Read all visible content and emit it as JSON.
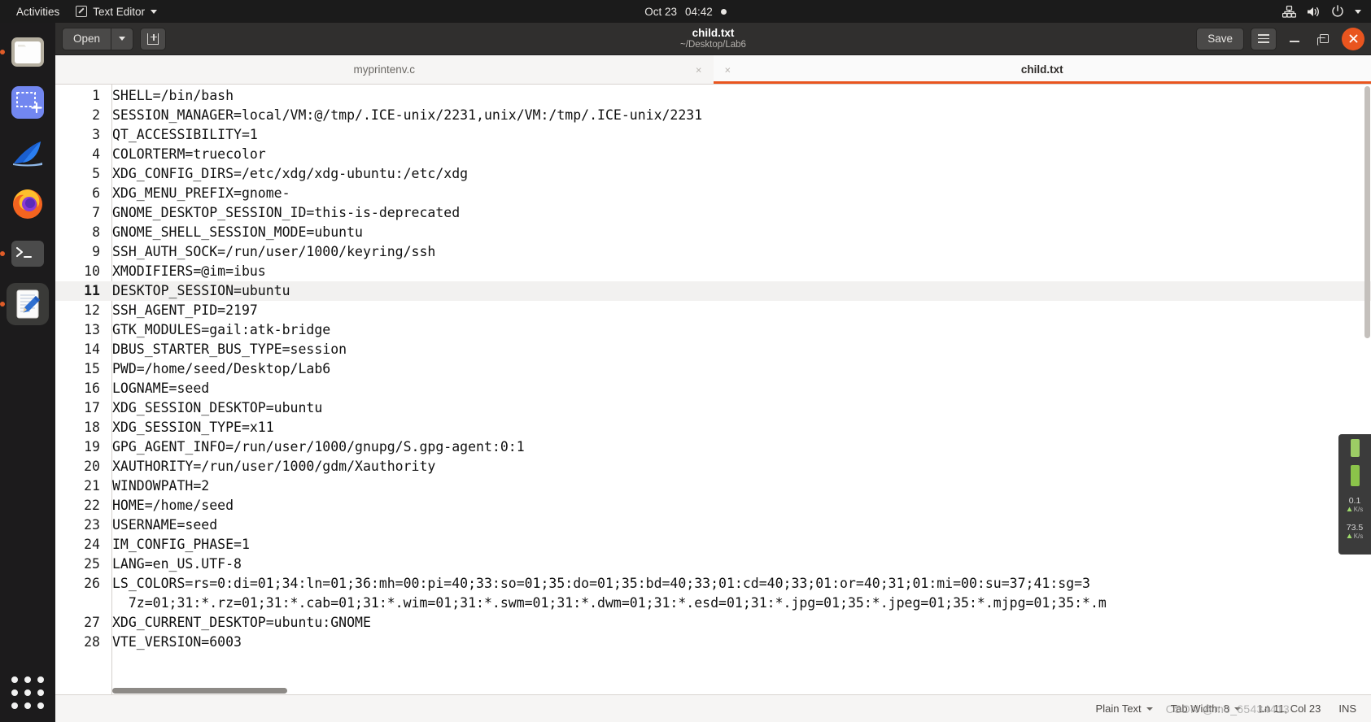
{
  "topbar": {
    "activities": "Activities",
    "app_menu": "Text Editor",
    "app_icon": "text-editor-icon",
    "clock_date": "Oct 23",
    "clock_time": "04:42",
    "indicator_dot": "recording-dot-icon",
    "tray": [
      "network-icon",
      "volume-icon",
      "power-icon",
      "chevron-down-icon"
    ]
  },
  "dock": {
    "items": [
      {
        "name": "files",
        "icon": "folder-icon",
        "running": true,
        "active": false
      },
      {
        "name": "screenshot",
        "icon": "screenshot-icon",
        "running": false,
        "active": false
      },
      {
        "name": "wireshark",
        "icon": "shark-fin-icon",
        "running": false,
        "active": false
      },
      {
        "name": "firefox",
        "icon": "firefox-icon",
        "running": false,
        "active": false
      },
      {
        "name": "terminal",
        "icon": "terminal-icon",
        "running": true,
        "active": false
      },
      {
        "name": "text-editor",
        "icon": "notepad-pencil-icon",
        "running": true,
        "active": true
      }
    ],
    "show_apps": "show-applications-icon"
  },
  "headerbar": {
    "open_label": "Open",
    "open_dropdown_icon": "chevron-down-icon",
    "new_tab_icon": "new-tab-icon",
    "title": "child.txt",
    "subtitle": "~/Desktop/Lab6",
    "save_label": "Save",
    "menu_icon": "hamburger-menu-icon",
    "minimize_icon": "minimize-icon",
    "maximize_icon": "maximize-icon",
    "close_icon": "close-icon",
    "accent_color": "#e9551f"
  },
  "tabs": [
    {
      "label": "myprintenv.c",
      "active": false,
      "close_icon": "×"
    },
    {
      "label": "child.txt",
      "active": true,
      "close_icon": "×"
    }
  ],
  "editor": {
    "current_line": 11,
    "lines": [
      {
        "n": 1,
        "text": "SHELL=/bin/bash"
      },
      {
        "n": 2,
        "text": "SESSION_MANAGER=local/VM:@/tmp/.ICE-unix/2231,unix/VM:/tmp/.ICE-unix/2231"
      },
      {
        "n": 3,
        "text": "QT_ACCESSIBILITY=1"
      },
      {
        "n": 4,
        "text": "COLORTERM=truecolor"
      },
      {
        "n": 5,
        "text": "XDG_CONFIG_DIRS=/etc/xdg/xdg-ubuntu:/etc/xdg"
      },
      {
        "n": 6,
        "text": "XDG_MENU_PREFIX=gnome-"
      },
      {
        "n": 7,
        "text": "GNOME_DESKTOP_SESSION_ID=this-is-deprecated"
      },
      {
        "n": 8,
        "text": "GNOME_SHELL_SESSION_MODE=ubuntu"
      },
      {
        "n": 9,
        "text": "SSH_AUTH_SOCK=/run/user/1000/keyring/ssh"
      },
      {
        "n": 10,
        "text": "XMODIFIERS=@im=ibus"
      },
      {
        "n": 11,
        "text": "DESKTOP_SESSION=ubuntu"
      },
      {
        "n": 12,
        "text": "SSH_AGENT_PID=2197"
      },
      {
        "n": 13,
        "text": "GTK_MODULES=gail:atk-bridge"
      },
      {
        "n": 14,
        "text": "DBUS_STARTER_BUS_TYPE=session"
      },
      {
        "n": 15,
        "text": "PWD=/home/seed/Desktop/Lab6"
      },
      {
        "n": 16,
        "text": "LOGNAME=seed"
      },
      {
        "n": 17,
        "text": "XDG_SESSION_DESKTOP=ubuntu"
      },
      {
        "n": 18,
        "text": "XDG_SESSION_TYPE=x11"
      },
      {
        "n": 19,
        "text": "GPG_AGENT_INFO=/run/user/1000/gnupg/S.gpg-agent:0:1"
      },
      {
        "n": 20,
        "text": "XAUTHORITY=/run/user/1000/gdm/Xauthority"
      },
      {
        "n": 21,
        "text": "WINDOWPATH=2"
      },
      {
        "n": 22,
        "text": "HOME=/home/seed"
      },
      {
        "n": 23,
        "text": "USERNAME=seed"
      },
      {
        "n": 24,
        "text": "IM_CONFIG_PHASE=1"
      },
      {
        "n": 25,
        "text": "LANG=en_US.UTF-8"
      },
      {
        "n": 26,
        "text": "LS_COLORS=rs=0:di=01;34:ln=01;36:mh=00:pi=40;33:so=01;35:do=01;35:bd=40;33;01:cd=40;33;01:or=40;31;01:mi=00:su=37;41:sg=3"
      },
      {
        "n": 26,
        "text": "  7z=01;31:*.rz=01;31:*.cab=01;31:*.wim=01;31:*.swm=01;31:*.dwm=01;31:*.esd=01;31:*.jpg=01;35:*.jpeg=01;35:*.mjpg=01;35:*.m",
        "continuation": true
      },
      {
        "n": 27,
        "text": "XDG_CURRENT_DESKTOP=ubuntu:GNOME"
      },
      {
        "n": 28,
        "text": "VTE_VERSION=6003"
      }
    ]
  },
  "netmon": {
    "down_value": "0.1",
    "down_unit": "K/s",
    "up_value": "73.5",
    "up_unit": "K/s"
  },
  "statusbar": {
    "language": "Plain Text",
    "tab_width_label": "Tab Width: 8",
    "position": "Ln 11, Col 23",
    "insert_mode": "INS",
    "watermark": "CSDN @m0_65434413"
  }
}
